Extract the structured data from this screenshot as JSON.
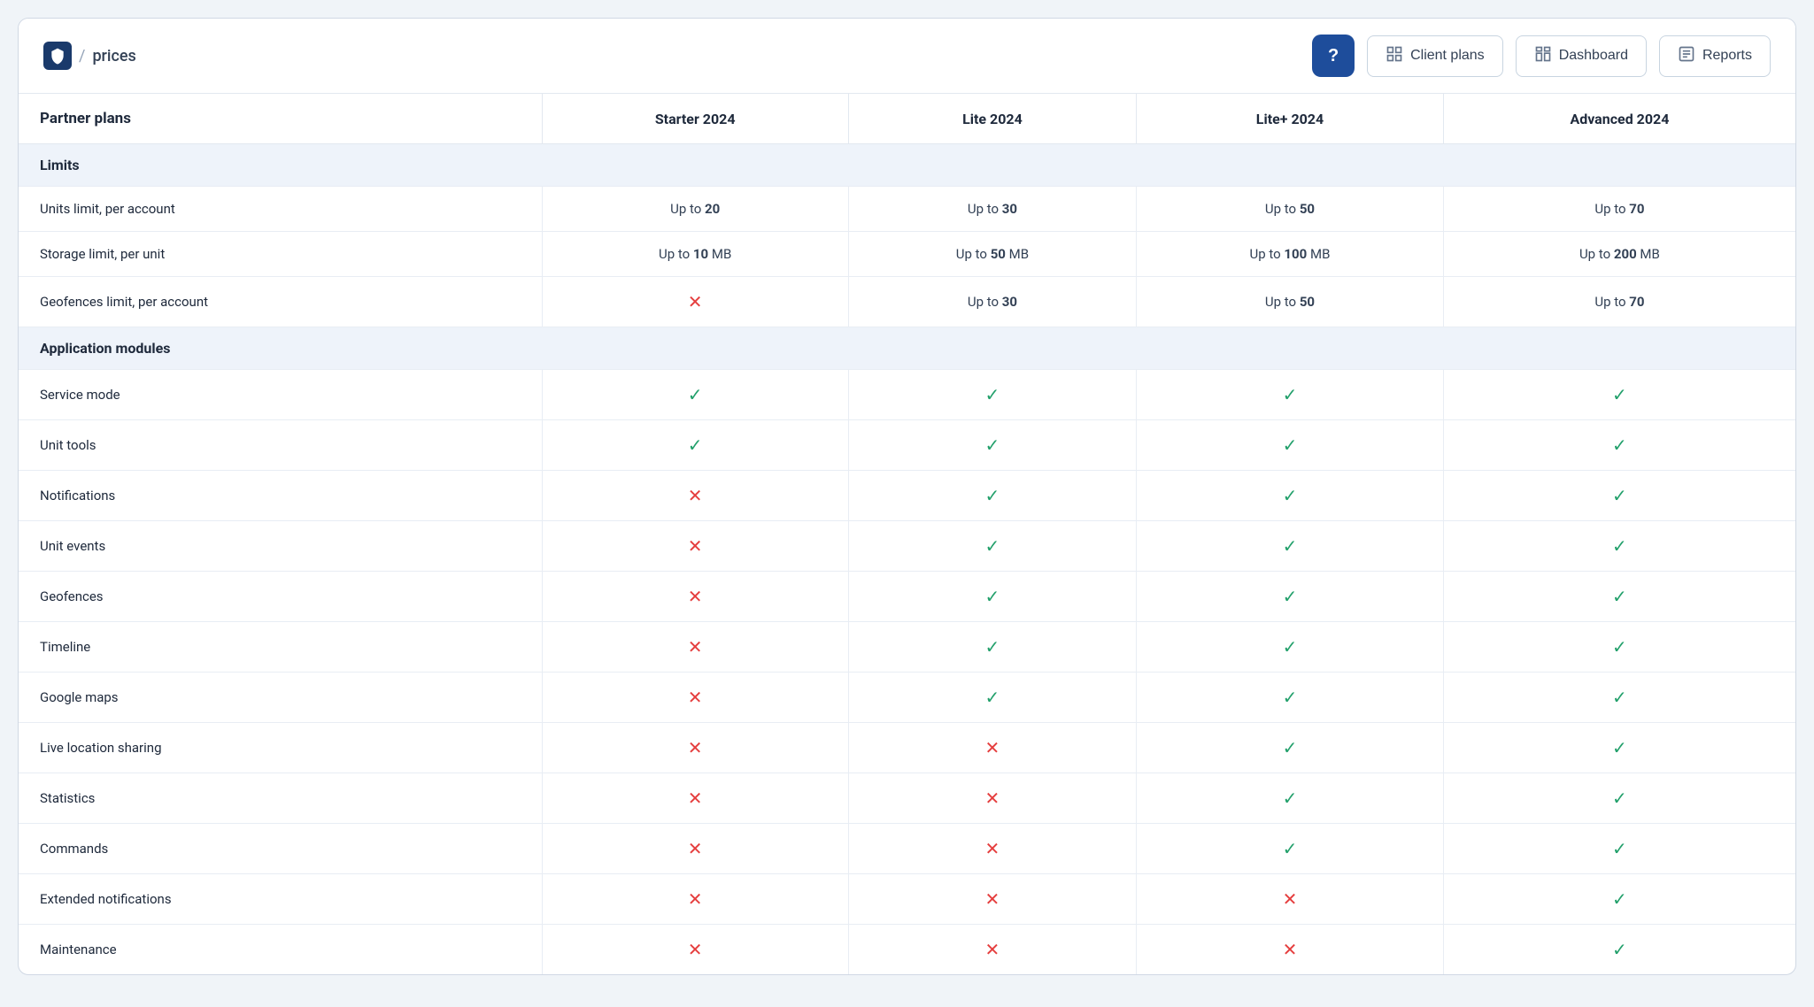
{
  "header": {
    "breadcrumb_separator": "/",
    "breadcrumb_label": "prices",
    "help_label": "?",
    "nav_buttons": [
      {
        "id": "client-plans",
        "label": "Client plans",
        "icon": "grid-icon"
      },
      {
        "id": "dashboard",
        "label": "Dashboard",
        "icon": "dashboard-icon"
      },
      {
        "id": "reports",
        "label": "Reports",
        "icon": "reports-icon"
      }
    ]
  },
  "table": {
    "columns": [
      {
        "id": "feature",
        "label": "Partner plans"
      },
      {
        "id": "starter",
        "label": "Starter 2024"
      },
      {
        "id": "lite",
        "label": "Lite 2024"
      },
      {
        "id": "lite_plus",
        "label": "Lite+ 2024"
      },
      {
        "id": "advanced",
        "label": "Advanced 2024"
      }
    ],
    "sections": [
      {
        "id": "limits",
        "label": "Limits",
        "rows": [
          {
            "feature": "Units limit, per account",
            "starter": {
              "type": "text",
              "value": "Up to ",
              "bold": "20"
            },
            "lite": {
              "type": "text",
              "value": "Up to ",
              "bold": "30"
            },
            "lite_plus": {
              "type": "text",
              "value": "Up to ",
              "bold": "50"
            },
            "advanced": {
              "type": "text",
              "value": "Up to ",
              "bold": "70"
            }
          },
          {
            "feature": "Storage limit, per unit",
            "starter": {
              "type": "text",
              "value": "Up to ",
              "bold": "10",
              "suffix": " MB"
            },
            "lite": {
              "type": "text",
              "value": "Up to ",
              "bold": "50",
              "suffix": " MB"
            },
            "lite_plus": {
              "type": "text",
              "value": "Up to ",
              "bold": "100",
              "suffix": " MB"
            },
            "advanced": {
              "type": "text",
              "value": "Up to ",
              "bold": "200",
              "suffix": " MB"
            }
          },
          {
            "feature": "Geofences limit, per account",
            "starter": {
              "type": "cross"
            },
            "lite": {
              "type": "text",
              "value": "Up to ",
              "bold": "30"
            },
            "lite_plus": {
              "type": "text",
              "value": "Up to ",
              "bold": "50"
            },
            "advanced": {
              "type": "text",
              "value": "Up to ",
              "bold": "70"
            }
          }
        ]
      },
      {
        "id": "application-modules",
        "label": "Application modules",
        "rows": [
          {
            "feature": "Service mode",
            "starter": {
              "type": "check"
            },
            "lite": {
              "type": "check"
            },
            "lite_plus": {
              "type": "check"
            },
            "advanced": {
              "type": "check"
            }
          },
          {
            "feature": "Unit tools",
            "starter": {
              "type": "check"
            },
            "lite": {
              "type": "check"
            },
            "lite_plus": {
              "type": "check"
            },
            "advanced": {
              "type": "check"
            }
          },
          {
            "feature": "Notifications",
            "starter": {
              "type": "cross"
            },
            "lite": {
              "type": "check"
            },
            "lite_plus": {
              "type": "check"
            },
            "advanced": {
              "type": "check"
            }
          },
          {
            "feature": "Unit events",
            "starter": {
              "type": "cross"
            },
            "lite": {
              "type": "check"
            },
            "lite_plus": {
              "type": "check"
            },
            "advanced": {
              "type": "check"
            }
          },
          {
            "feature": "Geofences",
            "starter": {
              "type": "cross"
            },
            "lite": {
              "type": "check"
            },
            "lite_plus": {
              "type": "check"
            },
            "advanced": {
              "type": "check"
            }
          },
          {
            "feature": "Timeline",
            "starter": {
              "type": "cross"
            },
            "lite": {
              "type": "check"
            },
            "lite_plus": {
              "type": "check"
            },
            "advanced": {
              "type": "check"
            }
          },
          {
            "feature": "Google maps",
            "starter": {
              "type": "cross"
            },
            "lite": {
              "type": "check"
            },
            "lite_plus": {
              "type": "check"
            },
            "advanced": {
              "type": "check"
            }
          },
          {
            "feature": "Live location sharing",
            "starter": {
              "type": "cross"
            },
            "lite": {
              "type": "cross"
            },
            "lite_plus": {
              "type": "check"
            },
            "advanced": {
              "type": "check"
            }
          },
          {
            "feature": "Statistics",
            "starter": {
              "type": "cross"
            },
            "lite": {
              "type": "cross"
            },
            "lite_plus": {
              "type": "check"
            },
            "advanced": {
              "type": "check"
            }
          },
          {
            "feature": "Commands",
            "starter": {
              "type": "cross"
            },
            "lite": {
              "type": "cross"
            },
            "lite_plus": {
              "type": "check"
            },
            "advanced": {
              "type": "check"
            }
          },
          {
            "feature": "Extended notifications",
            "starter": {
              "type": "cross"
            },
            "lite": {
              "type": "cross"
            },
            "lite_plus": {
              "type": "cross"
            },
            "advanced": {
              "type": "check"
            }
          },
          {
            "feature": "Maintenance",
            "starter": {
              "type": "cross"
            },
            "lite": {
              "type": "cross"
            },
            "lite_plus": {
              "type": "cross"
            },
            "advanced": {
              "type": "check"
            }
          }
        ]
      }
    ]
  }
}
